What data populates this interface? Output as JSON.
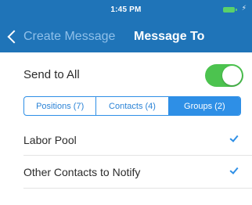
{
  "status_bar": {
    "time": "1:45 PM",
    "battery_color": "#5ad16a",
    "charging_icon": "bolt-icon"
  },
  "nav": {
    "back_label": "Create Message",
    "title": "Message To",
    "background": "#1f74b8"
  },
  "send_all": {
    "label": "Send to All",
    "enabled": true,
    "toggle_color": "#4cc34f"
  },
  "segments": [
    {
      "label": "Positions (7)",
      "active": false
    },
    {
      "label": "Contacts (4)",
      "active": false
    },
    {
      "label": "Groups (2)",
      "active": true
    }
  ],
  "groups": [
    {
      "label": "Labor Pool",
      "checked": true
    },
    {
      "label": "Other Contacts to Notify",
      "checked": true
    }
  ],
  "accent_color": "#2e8fe6"
}
